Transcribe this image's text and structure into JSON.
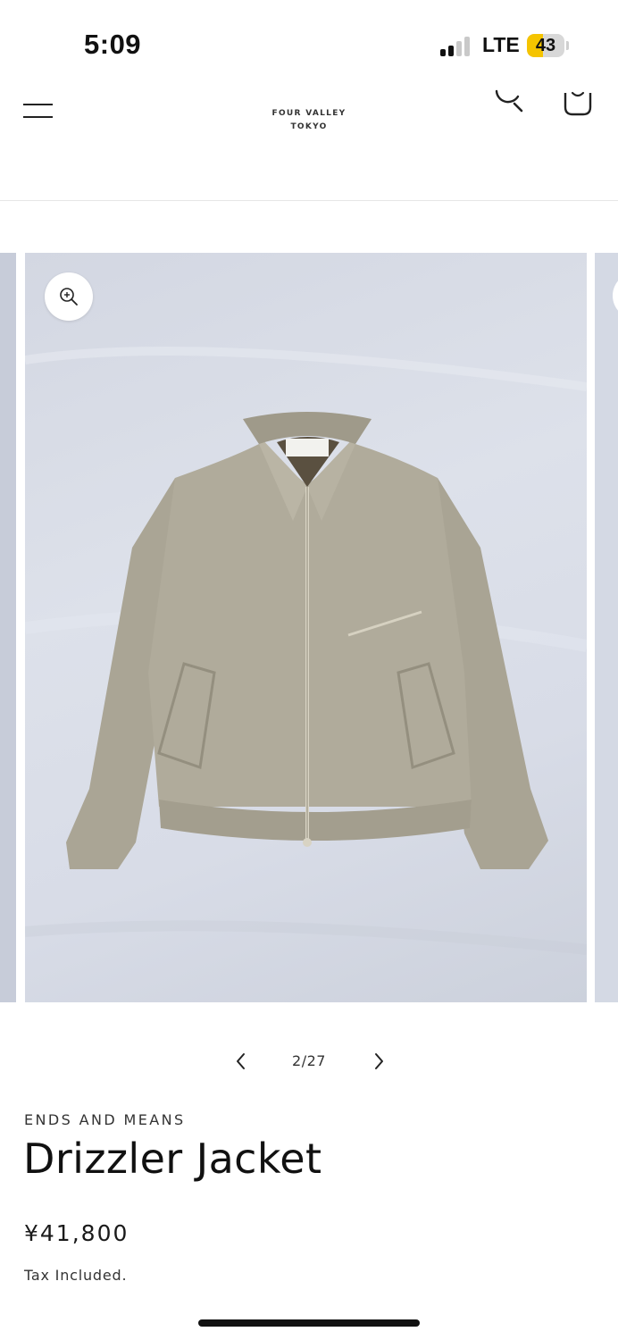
{
  "status_bar": {
    "time": "5:09",
    "carrier": "LTE",
    "battery_level": "43",
    "battery_fraction": 0.43,
    "signal_bars_active": 2,
    "signal_bars_total": 4,
    "battery_color": "#f5c400"
  },
  "header": {
    "logo_line1": "FOUR VALLEY",
    "logo_line2": "TOKYO",
    "menu_icon": "hamburger-menu-icon",
    "search_icon": "search-icon",
    "cart_icon": "cart-icon"
  },
  "gallery": {
    "image_alt": "Drizzler Jacket photo",
    "zoom_icon": "zoom-in-icon",
    "current": "2/27",
    "prev_icon": "chevron-left-icon",
    "next_icon": "chevron-right-icon"
  },
  "product": {
    "vendor": "ENDS AND MEANS",
    "title": "Drizzler Jacket",
    "price": "¥41,800",
    "tax_note": "Tax Included."
  },
  "colors": {
    "text": "#111111",
    "jacket": "#a8a393",
    "backdrop": "#d8dce6",
    "divider": "#e6e6e6"
  }
}
